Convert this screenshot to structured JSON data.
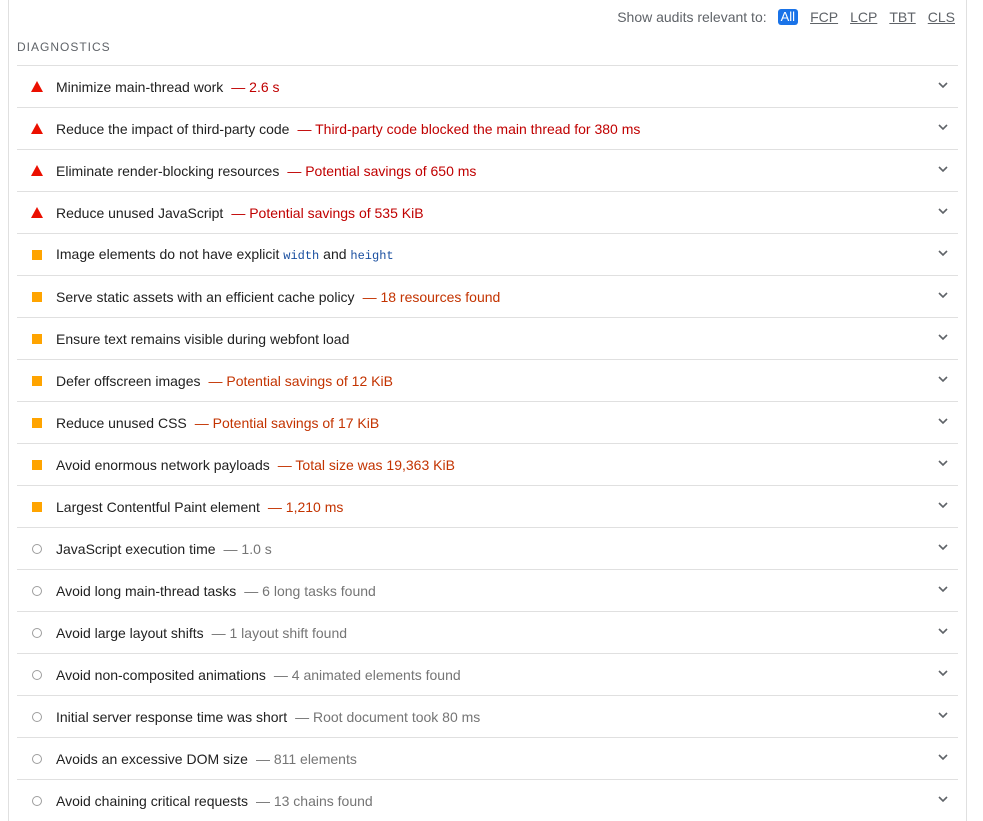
{
  "filter": {
    "label": "Show audits relevant to:",
    "chips": [
      "All",
      "FCP",
      "LCP",
      "TBT",
      "CLS"
    ],
    "active": "All"
  },
  "section": {
    "title": "DIAGNOSTICS"
  },
  "colors": {
    "fail": "#eb0f00",
    "average": "#ffa400",
    "info": "#9e9e9e",
    "accent": "#1a73e8"
  },
  "audits": [
    {
      "title": "Minimize main-thread work",
      "display": "— 2.6 s",
      "status": "fail",
      "icon": "fail-triangle-icon"
    },
    {
      "title": "Reduce the impact of third-party code",
      "display": "— Third-party code blocked the main thread for 380 ms",
      "status": "fail",
      "icon": "fail-triangle-icon"
    },
    {
      "title": "Eliminate render-blocking resources",
      "display": "— Potential savings of 650 ms",
      "status": "fail",
      "icon": "fail-triangle-icon"
    },
    {
      "title": "Reduce unused JavaScript",
      "display": "— Potential savings of 535 KiB",
      "status": "fail",
      "icon": "fail-triangle-icon"
    },
    {
      "title_parts": [
        "Image elements do not have explicit ",
        "width",
        " and ",
        "height"
      ],
      "status": "average",
      "icon": "average-square-icon"
    },
    {
      "title": "Serve static assets with an efficient cache policy",
      "display": "— 18 resources found",
      "status": "average",
      "icon": "average-square-icon"
    },
    {
      "title": "Ensure text remains visible during webfont load",
      "display": "",
      "status": "average",
      "icon": "average-square-icon"
    },
    {
      "title": "Defer offscreen images",
      "display": "— Potential savings of 12 KiB",
      "status": "average",
      "icon": "average-square-icon"
    },
    {
      "title": "Reduce unused CSS",
      "display": "— Potential savings of 17 KiB",
      "status": "average",
      "icon": "average-square-icon"
    },
    {
      "title": "Avoid enormous network payloads",
      "display": "— Total size was 19,363 KiB",
      "status": "average",
      "icon": "average-square-icon"
    },
    {
      "title": "Largest Contentful Paint element",
      "display": "— 1,210 ms",
      "status": "average",
      "icon": "average-square-icon"
    },
    {
      "title": "JavaScript execution time",
      "display": "— 1.0 s",
      "status": "info",
      "icon": "info-circle-icon"
    },
    {
      "title": "Avoid long main-thread tasks",
      "display": "— 6 long tasks found",
      "status": "info",
      "icon": "info-circle-icon"
    },
    {
      "title": "Avoid large layout shifts",
      "display": "— 1 layout shift found",
      "status": "info",
      "icon": "info-circle-icon"
    },
    {
      "title": "Avoid non-composited animations",
      "display": "— 4 animated elements found",
      "status": "info",
      "icon": "info-circle-icon"
    },
    {
      "title": "Initial server response time was short",
      "display": "— Root document took 80 ms",
      "status": "info",
      "icon": "info-circle-icon"
    },
    {
      "title": "Avoids an excessive DOM size",
      "display": "— 811 elements",
      "status": "info",
      "icon": "info-circle-icon"
    },
    {
      "title": "Avoid chaining critical requests",
      "display": "— 13 chains found",
      "status": "info",
      "icon": "info-circle-icon"
    }
  ]
}
